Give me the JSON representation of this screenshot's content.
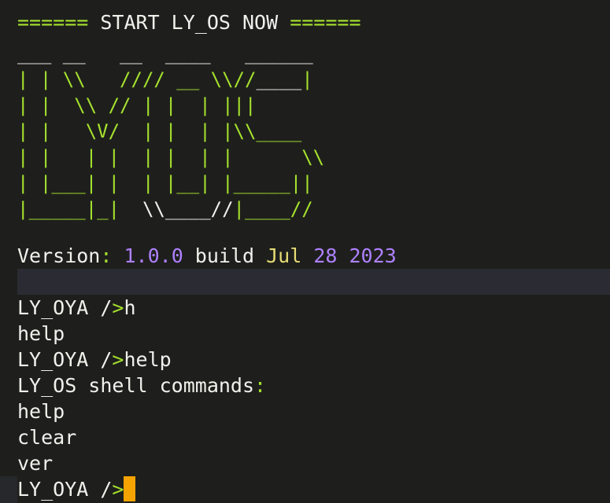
{
  "header": {
    "eq_left": "======",
    "title": " START LY_OS NOW ",
    "eq_right": "======"
  },
  "logo": {
    "row0": "___ __   __  ____   ______",
    "row1": {
      "a": "| | \\\\   //// __ \\\\//",
      "b": "____",
      "c": "|"
    },
    "row2": "| |  \\\\ // | |  | |||",
    "row3": "| |   \\V/  | |  | |\\\\____",
    "row4": "| |   | |  | |  | |      \\\\",
    "row5": "| |___| |  | |__| |_____||",
    "row6": {
      "a": "|_____|_|  ",
      "b": "\\\\____//",
      "c": "|____//"
    }
  },
  "version": {
    "label": "Version",
    "colon": ":",
    "number": "1.0.0",
    "build_word": " build ",
    "month": "Jul",
    "day": "28",
    "year": "2023"
  },
  "shell": {
    "prompt_user": "LY_OYA /",
    "prompt_arrow": ">",
    "lines": [
      {
        "kind": "prompt",
        "cmd": "h"
      },
      {
        "kind": "out",
        "text": "help"
      },
      {
        "kind": "prompt",
        "cmd": "help"
      },
      {
        "kind": "out",
        "text": "LY_OS shell commands",
        "colon": ":"
      },
      {
        "kind": "out",
        "text": "help"
      },
      {
        "kind": "out",
        "text": "clear"
      },
      {
        "kind": "out",
        "text": "ver"
      },
      {
        "kind": "prompt",
        "cmd": ""
      }
    ]
  },
  "colors": {
    "background": "#1e1f1c",
    "foreground": "#f1f1ec",
    "green": "#a6e22e",
    "purple": "#ae81ff",
    "yellow": "#e6db74",
    "cursor": "#f5a300",
    "highlight_row": "#2b2c33"
  }
}
